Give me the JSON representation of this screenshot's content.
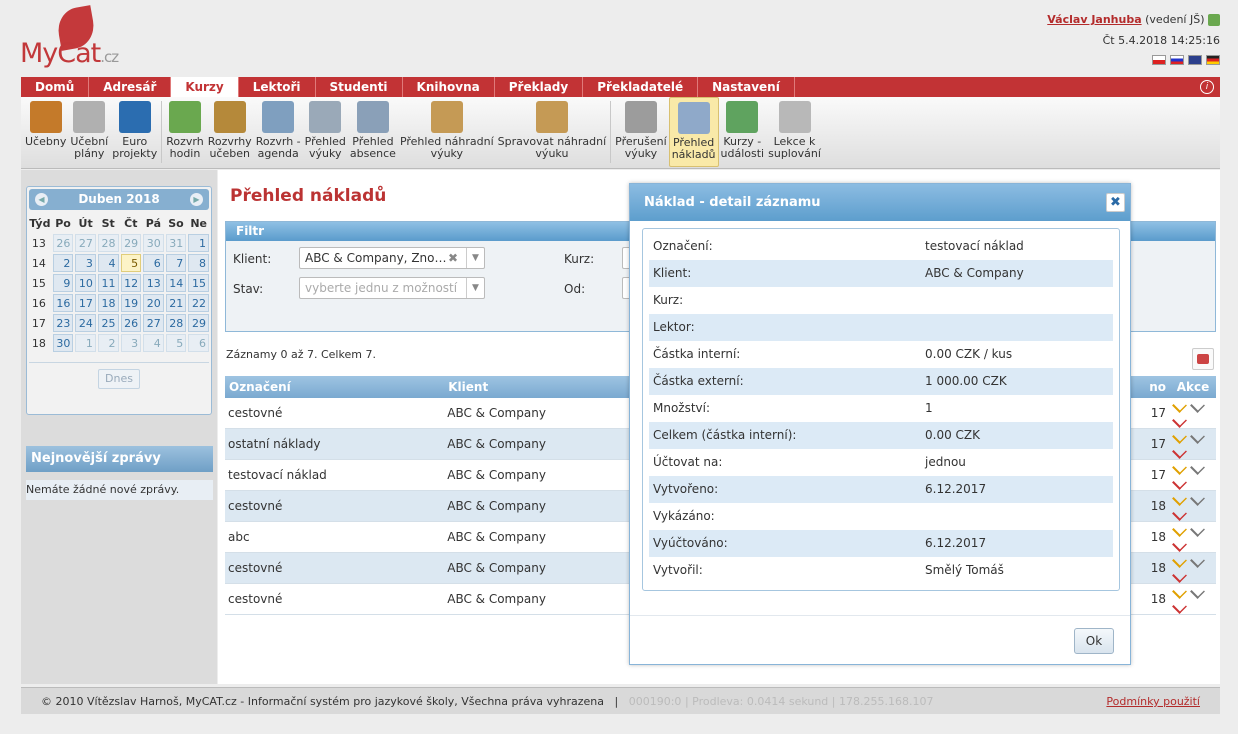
{
  "logo": {
    "brand": "MyCat",
    "tld": ".cz"
  },
  "user": {
    "name": "Václav Janhuba",
    "role": "(vedení JŠ)",
    "datetime": "Čt 5.4.2018 14:25:16"
  },
  "nav": {
    "tabs": [
      "Domů",
      "Adresář",
      "Kurzy",
      "Lektoři",
      "Studenti",
      "Knihovna",
      "Překlady",
      "Překladatelé",
      "Nastavení"
    ],
    "active": "Kurzy",
    "info_icon": "i"
  },
  "toolbar": {
    "items": [
      {
        "l1": "Učebny",
        "l2": "",
        "color": "#c47a2a"
      },
      {
        "l1": "Učební",
        "l2": "plány",
        "color": "#b0b0b0"
      },
      {
        "l1": "Euro",
        "l2": "projekty",
        "color": "#2b6db0"
      },
      {
        "l1": "Rozvrh",
        "l2": "hodin",
        "color": "#6aa84f"
      },
      {
        "l1": "Rozvrhy",
        "l2": "učeben",
        "color": "#b5893a"
      },
      {
        "l1": "Rozvrh -",
        "l2": "agenda",
        "color": "#7f9fbf"
      },
      {
        "l1": "Přehled",
        "l2": "výuky",
        "color": "#9aa9b8"
      },
      {
        "l1": "Přehled",
        "l2": "absence",
        "color": "#8aa0b8"
      },
      {
        "l1": "Přehled náhradní",
        "l2": "výuky",
        "color": "#c59a55"
      },
      {
        "l1": "Spravovat náhradní",
        "l2": "výuku",
        "color": "#c59a55"
      },
      {
        "l1": "Přerušení",
        "l2": "výuky",
        "color": "#9c9c9c"
      },
      {
        "l1": "Přehled",
        "l2": "nákladů",
        "color": "#8fa9c9"
      },
      {
        "l1": "Kurzy -",
        "l2": "události",
        "color": "#5fa35f"
      },
      {
        "l1": "Lekce k",
        "l2": "suplování",
        "color": "#b8b8b8"
      }
    ],
    "active_index": 11
  },
  "calendar": {
    "month": "Duben 2018",
    "headers": [
      "Týd",
      "Po",
      "Út",
      "St",
      "Čt",
      "Pá",
      "So",
      "Ne"
    ],
    "weeks": [
      {
        "wk": "13",
        "days": [
          {
            "v": "26",
            "o": true
          },
          {
            "v": "27",
            "o": true
          },
          {
            "v": "28",
            "o": true
          },
          {
            "v": "29",
            "o": true
          },
          {
            "v": "30",
            "o": true
          },
          {
            "v": "31",
            "o": true
          },
          {
            "v": "1",
            "o": false
          }
        ]
      },
      {
        "wk": "14",
        "days": [
          {
            "v": "2"
          },
          {
            "v": "3"
          },
          {
            "v": "4"
          },
          {
            "v": "5",
            "t": true
          },
          {
            "v": "6"
          },
          {
            "v": "7"
          },
          {
            "v": "8"
          }
        ]
      },
      {
        "wk": "15",
        "days": [
          {
            "v": "9"
          },
          {
            "v": "10"
          },
          {
            "v": "11"
          },
          {
            "v": "12"
          },
          {
            "v": "13"
          },
          {
            "v": "14"
          },
          {
            "v": "15"
          }
        ]
      },
      {
        "wk": "16",
        "days": [
          {
            "v": "16"
          },
          {
            "v": "17"
          },
          {
            "v": "18"
          },
          {
            "v": "19"
          },
          {
            "v": "20"
          },
          {
            "v": "21"
          },
          {
            "v": "22"
          }
        ]
      },
      {
        "wk": "17",
        "days": [
          {
            "v": "23"
          },
          {
            "v": "24"
          },
          {
            "v": "25"
          },
          {
            "v": "26"
          },
          {
            "v": "27"
          },
          {
            "v": "28"
          },
          {
            "v": "29"
          }
        ]
      },
      {
        "wk": "18",
        "days": [
          {
            "v": "30"
          },
          {
            "v": "1",
            "o": true
          },
          {
            "v": "2",
            "o": true
          },
          {
            "v": "3",
            "o": true
          },
          {
            "v": "4",
            "o": true
          },
          {
            "v": "5",
            "o": true
          },
          {
            "v": "6",
            "o": true
          }
        ]
      }
    ],
    "today_button": "Dnes"
  },
  "news": {
    "title": "Nejnovější zprávy",
    "empty": "Nemáte žádné nové zprávy."
  },
  "main": {
    "title": "Přehled nákladů",
    "filter": {
      "title": "Filtr",
      "client_label": "Klient:",
      "client_value": "ABC & Company, Zno…",
      "state_label": "Stav:",
      "state_placeholder": "vyberte jednu z možností",
      "course_label": "Kurz:",
      "from_label": "Od:"
    },
    "count": "Záznamy 0 až 7. Celkem 7.",
    "columns": {
      "designation": "Označení",
      "client": "Klient",
      "partial": "no",
      "actions": "Akce"
    },
    "rows": [
      {
        "name": "cestovné",
        "client": "ABC & Company",
        "tail": "17"
      },
      {
        "name": "ostatní náklady",
        "client": "ABC & Company",
        "tail": "17"
      },
      {
        "name": "testovací náklad",
        "client": "ABC & Company",
        "tail": "17"
      },
      {
        "name": "cestovné",
        "client": "ABC & Company",
        "tail": "18"
      },
      {
        "name": "abc",
        "client": "ABC & Company",
        "tail": "18"
      },
      {
        "name": "cestovné",
        "client": "ABC & Company",
        "tail": "18"
      },
      {
        "name": "cestovné",
        "client": "ABC & Company",
        "tail": "18"
      }
    ]
  },
  "dialog": {
    "title": "Náklad - detail záznamu",
    "close_icon": "✖",
    "fields": [
      {
        "k": "Označení:",
        "v": "testovací náklad"
      },
      {
        "k": "Klient:",
        "v": "ABC & Company"
      },
      {
        "k": "Kurz:",
        "v": ""
      },
      {
        "k": "Lektor:",
        "v": ""
      },
      {
        "k": "Částka interní:",
        "v": "0.00 CZK / kus"
      },
      {
        "k": "Částka externí:",
        "v": "1 000.00 CZK"
      },
      {
        "k": "Množství:",
        "v": "1"
      },
      {
        "k": "Celkem (částka interní):",
        "v": "0.00 CZK"
      },
      {
        "k": "Účtovat na:",
        "v": "jednou"
      },
      {
        "k": "Vytvořeno:",
        "v": "6.12.2017"
      },
      {
        "k": "Vykázáno:",
        "v": ""
      },
      {
        "k": "Vyúčtováno:",
        "v": "6.12.2017"
      },
      {
        "k": "Vytvořil:",
        "v": "Smělý Tomáš"
      }
    ],
    "ok": "Ok"
  },
  "footer": {
    "copyright": "© 2010 Vítězslav Harnoš, MyCAT.cz - Informační systém pro jazykové školy, Všechna práva vyhrazena",
    "sep": "|",
    "id": "000190:0",
    "delay": "Prodleva: 0.0414 sekund",
    "ip": "178.255.168.107",
    "terms": "Podmínky použití"
  },
  "colors": {
    "brand": "#c23335",
    "header_blue": "#7aa9d0",
    "row_alt": "#dce8f2"
  }
}
